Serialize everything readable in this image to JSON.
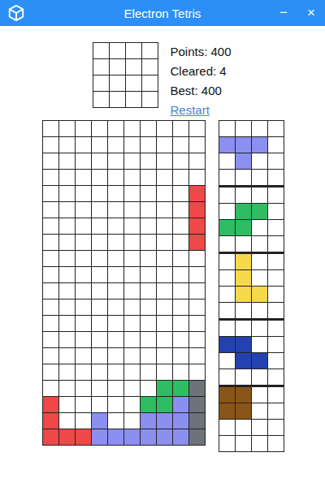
{
  "window": {
    "title": "Electron Tetris",
    "controls": [
      "−",
      "×"
    ]
  },
  "hold": {
    "rows": [
      [
        "",
        "",
        "",
        ""
      ],
      [
        "",
        "",
        "",
        ""
      ],
      [
        "",
        "",
        "",
        ""
      ],
      [
        "",
        "",
        "",
        ""
      ]
    ]
  },
  "stats": [
    "Points: 400",
    "Cleared: 4",
    "Best: 400"
  ],
  "restart": "Restart",
  "board": {
    "rows": [
      [
        "",
        "",
        "",
        "",
        "",
        "",
        "",
        "",
        "",
        ""
      ],
      [
        "",
        "",
        "",
        "",
        "",
        "",
        "",
        "",
        "",
        ""
      ],
      [
        "",
        "",
        "",
        "",
        "",
        "",
        "",
        "",
        "",
        ""
      ],
      [
        "",
        "",
        "",
        "",
        "",
        "",
        "",
        "",
        "",
        ""
      ],
      [
        "",
        "",
        "",
        "",
        "",
        "",
        "",
        "",
        "",
        "#ee4848"
      ],
      [
        "",
        "",
        "",
        "",
        "",
        "",
        "",
        "",
        "",
        "#ee4848"
      ],
      [
        "",
        "",
        "",
        "",
        "",
        "",
        "",
        "",
        "",
        "#ee4848"
      ],
      [
        "",
        "",
        "",
        "",
        "",
        "",
        "",
        "",
        "",
        "#ee4848"
      ],
      [
        "",
        "",
        "",
        "",
        "",
        "",
        "",
        "",
        "",
        ""
      ],
      [
        "",
        "",
        "",
        "",
        "",
        "",
        "",
        "",
        "",
        ""
      ],
      [
        "",
        "",
        "",
        "",
        "",
        "",
        "",
        "",
        "",
        ""
      ],
      [
        "",
        "",
        "",
        "",
        "",
        "",
        "",
        "",
        "",
        ""
      ],
      [
        "",
        "",
        "",
        "",
        "",
        "",
        "",
        "",
        "",
        ""
      ],
      [
        "",
        "",
        "",
        "",
        "",
        "",
        "",
        "",
        "",
        ""
      ],
      [
        "",
        "",
        "",
        "",
        "",
        "",
        "",
        "",
        "",
        ""
      ],
      [
        "",
        "",
        "",
        "",
        "",
        "",
        "",
        "",
        "",
        ""
      ],
      [
        "",
        "",
        "",
        "",
        "",
        "",
        "",
        "#2ebd62",
        "#2ebd62",
        "#6c737a"
      ],
      [
        "#ee4848",
        "",
        "",
        "",
        "",
        "",
        "#2ebd62",
        "#2ebd62",
        "#8b8ff0",
        "#6c737a"
      ],
      [
        "#ee4848",
        "",
        "",
        "#8b8ff0",
        "",
        "",
        "#8b8ff0",
        "#8b8ff0",
        "#8b8ff0",
        "#6c737a"
      ],
      [
        "#ee4848",
        "#ee4848",
        "#ee4848",
        "#8b8ff0",
        "#8b8ff0",
        "#8b8ff0",
        "#8b8ff0",
        "#8b8ff0",
        "#8b8ff0",
        "#6c737a"
      ]
    ]
  },
  "next": [
    {
      "rows": [
        [
          "",
          "",
          "",
          ""
        ],
        [
          "#8b8ff0",
          "#8b8ff0",
          "#8b8ff0",
          ""
        ],
        [
          "",
          "#8b8ff0",
          "",
          ""
        ],
        [
          "",
          "",
          "",
          ""
        ]
      ]
    },
    {
      "rows": [
        [
          "",
          "",
          "",
          ""
        ],
        [
          "",
          "#2ebd62",
          "#2ebd62",
          ""
        ],
        [
          "#2ebd62",
          "#2ebd62",
          "",
          ""
        ],
        [
          "",
          "",
          "",
          ""
        ]
      ]
    },
    {
      "rows": [
        [
          "",
          "#f7d94c",
          "",
          ""
        ],
        [
          "",
          "#f7d94c",
          "",
          ""
        ],
        [
          "",
          "#f7d94c",
          "#f7d94c",
          ""
        ],
        [
          "",
          "",
          "",
          ""
        ]
      ]
    },
    {
      "rows": [
        [
          "",
          "",
          "",
          ""
        ],
        [
          "#2342b0",
          "#2342b0",
          "",
          ""
        ],
        [
          "",
          "#2342b0",
          "#2342b0",
          ""
        ],
        [
          "",
          "",
          "",
          ""
        ]
      ]
    },
    {
      "rows": [
        [
          "#8a5518",
          "#8a5518",
          "",
          ""
        ],
        [
          "#8a5518",
          "#8a5518",
          "",
          ""
        ],
        [
          "",
          "",
          "",
          ""
        ],
        [
          "",
          "",
          "",
          ""
        ]
      ]
    }
  ]
}
